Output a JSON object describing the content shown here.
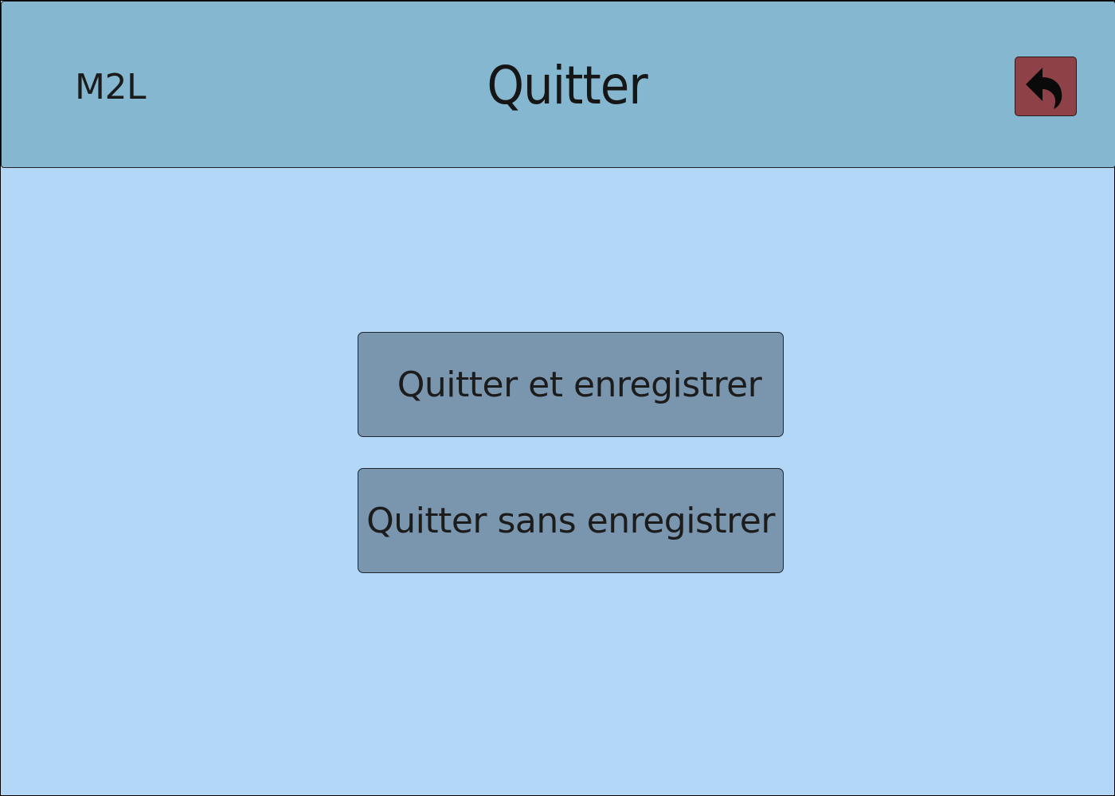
{
  "colors": {
    "page_background": "#b3d7f7",
    "header_background": "#85b8d0",
    "back_button_background": "#8e4147",
    "action_button_background": "#7a95ae"
  },
  "header": {
    "brand": "M2L",
    "title": "Quitter",
    "back_button": {
      "icon": "undo-arrow-icon"
    }
  },
  "actions": {
    "save_and_quit": "Quitter et enregistrer",
    "quit_without_saving": "Quitter sans enregistrer"
  }
}
